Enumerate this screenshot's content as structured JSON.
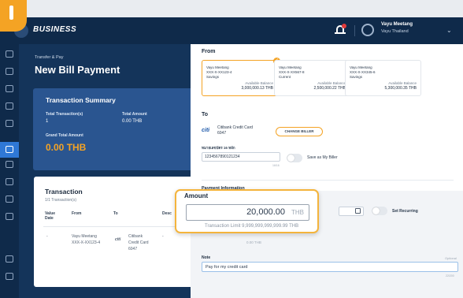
{
  "header": {
    "logo_text": "BUSINESS",
    "user_name": "Vayu Meetang",
    "user_org": "Vayu Thailand"
  },
  "left": {
    "breadcrumb": "Transfer & Pay",
    "title": "New Bill Payment",
    "summary": {
      "title": "Transaction Summary",
      "total_txn_label": "Total Transaction(s)",
      "total_txn_value": "1",
      "total_amount_label": "Total Amount",
      "total_amount_value": "0.00 THB",
      "grand_label": "Grand Total Amount",
      "grand_value": "0.00 THB"
    },
    "transaction": {
      "title": "Transaction",
      "subtitle": "1/1 Transaction(s)",
      "headers": [
        "Value Date",
        "From",
        "To",
        "Desc"
      ],
      "row": {
        "value_date": "-",
        "from_name": "Vayu Meetang",
        "from_acct": "XXX-X-XX123-4",
        "to_logo": "citi",
        "to_name_1": "Citibank",
        "to_name_2": "Credit Card",
        "to_acct": "6047",
        "desc": "-"
      }
    }
  },
  "main": {
    "from_label": "From",
    "accounts": [
      {
        "name": "Vayu Meetang",
        "number": "XXX-X-XX123-4",
        "type": "Savings",
        "balance_label": "Available Balance",
        "balance": "3,000,000.13 THB",
        "selected": true
      },
      {
        "name": "Vayu Meetang",
        "number": "XXX-X-XX567-8",
        "type": "Current",
        "balance_label": "Available Balance",
        "balance": "2,500,000.22 THB",
        "selected": false
      },
      {
        "name": "Vayu Meetang",
        "number": "XXX-X-XX345-6",
        "type": "Savings",
        "balance_label": "Available Balance",
        "balance": "5,300,000.35 THB",
        "selected": false
      }
    ],
    "to_label": "To",
    "biller": {
      "logo": "citi",
      "name": "Citibank Credit Card",
      "code": "6047",
      "change_label": "CHANGE BILLER"
    },
    "ref_label": "หมายเลขบัตร 16 หลัก",
    "ref_value": "1234567890121234",
    "ref_count": "16/16",
    "save_biller_label": "Save as My Biller",
    "payment_info_label": "Payment Information",
    "recurring_label": "Set Recurring",
    "fee_value": "0.00 THB",
    "note_label": "Note",
    "note_optional": "Optional",
    "note_value": "Pay for my credit card",
    "note_count": "22/200"
  },
  "amount_popup": {
    "label": "Amount",
    "value": "20,000.00",
    "currency": "THB",
    "limit": "Transaction Limit 9,999,999,999,999.99 THB"
  }
}
